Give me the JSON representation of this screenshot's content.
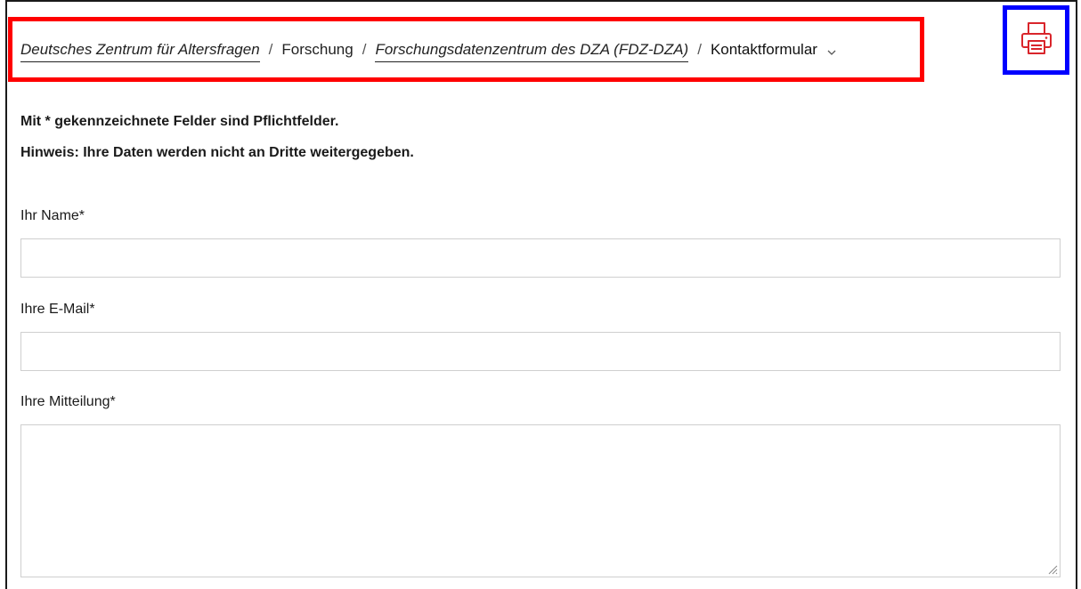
{
  "breadcrumb": {
    "items": [
      {
        "label": "Deutsches Zentrum für Altersfragen"
      },
      {
        "label": "Forschung"
      },
      {
        "label": "Forschungsdatenzentrum des DZA (FDZ-DZA)"
      },
      {
        "label": "Kontaktformular"
      }
    ],
    "separator": "/"
  },
  "toolbar": {
    "print_icon": "printer-icon",
    "print_icon_color": "#d9252b"
  },
  "form": {
    "notice_required": "Mit * gekennzeichnete Felder sind Pflichtfelder.",
    "notice_privacy": "Hinweis: Ihre Daten werden nicht an Dritte weitergegeben.",
    "name_label": "Ihr Name*",
    "name_value": "",
    "email_label": "Ihre E-Mail*",
    "email_value": "",
    "message_label": "Ihre Mitteilung*",
    "message_value": ""
  },
  "highlights": {
    "breadcrumb_box_color": "#ff0000",
    "print_box_color": "#0000ff"
  }
}
